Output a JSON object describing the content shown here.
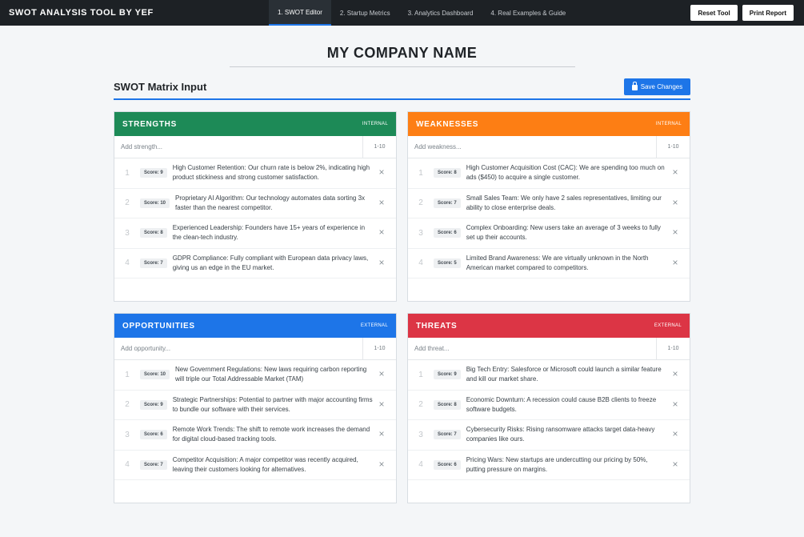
{
  "brand": "SWOT ANALYSIS TOOL BY YEF",
  "tabs": [
    "1. SWOT Editor",
    "2. Startup Metrics",
    "3. Analytics Dashboard",
    "4. Real Examples & Guide"
  ],
  "actions": {
    "reset": "Reset Tool",
    "print": "Print Report"
  },
  "company": {
    "name": "MY COMPANY NAME"
  },
  "matrix": {
    "title": "SWOT Matrix Input",
    "save_label": "Save Changes"
  },
  "colors": {
    "strengths": "#1d8a57",
    "weaknesses": "#fd7e14",
    "opportunities": "#1d75e8",
    "threats": "#dc3545",
    "accent": "#1d75e8"
  },
  "quadrants": {
    "strengths": {
      "title": "STRENGTHS",
      "tag": "INTERNAL",
      "placeholder": "Add strength...",
      "score_placeholder": "1-10",
      "items": [
        {
          "num": "1",
          "score": "Score: 9",
          "text": "High Customer Retention: Our churn rate is below 2%, indicating high product stickiness and strong customer satisfaction."
        },
        {
          "num": "2",
          "score": "Score: 10",
          "text": "Proprietary AI Algorithm: Our technology automates data sorting 3x faster than the nearest competitor."
        },
        {
          "num": "3",
          "score": "Score: 8",
          "text": "Experienced Leadership: Founders have 15+ years of experience in the clean-tech industry."
        },
        {
          "num": "4",
          "score": "Score: 7",
          "text": "GDPR Compliance: Fully compliant with European data privacy laws, giving us an edge in the EU market."
        }
      ]
    },
    "weaknesses": {
      "title": "WEAKNESSES",
      "tag": "INTERNAL",
      "placeholder": "Add weakness...",
      "score_placeholder": "1-10",
      "items": [
        {
          "num": "1",
          "score": "Score: 8",
          "text": "High Customer Acquisition Cost (CAC): We are spending too much on ads ($450) to acquire a single customer."
        },
        {
          "num": "2",
          "score": "Score: 7",
          "text": "Small Sales Team: We only have 2 sales representatives, limiting our ability to close enterprise deals."
        },
        {
          "num": "3",
          "score": "Score: 6",
          "text": "Complex Onboarding: New users take an average of 3 weeks to fully set up their accounts."
        },
        {
          "num": "4",
          "score": "Score: 5",
          "text": "Limited Brand Awareness: We are virtually unknown in the North American market compared to competitors."
        }
      ]
    },
    "opportunities": {
      "title": "OPPORTUNITIES",
      "tag": "EXTERNAL",
      "placeholder": "Add opportunity...",
      "score_placeholder": "1-10",
      "items": [
        {
          "num": "1",
          "score": "Score: 10",
          "text": "New Government Regulations: New laws requiring carbon reporting will triple our Total Addressable Market (TAM)"
        },
        {
          "num": "2",
          "score": "Score: 9",
          "text": "Strategic Partnerships: Potential to partner with major accounting firms to bundle our software with their services."
        },
        {
          "num": "3",
          "score": "Score: 6",
          "text": "Remote Work Trends: The shift to remote work increases the demand for digital cloud-based tracking tools."
        },
        {
          "num": "4",
          "score": "Score: 7",
          "text": "Competitor Acquisition: A major competitor was recently acquired, leaving their customers looking for alternatives."
        }
      ]
    },
    "threats": {
      "title": "THREATS",
      "tag": "EXTERNAL",
      "placeholder": "Add threat...",
      "score_placeholder": "1-10",
      "items": [
        {
          "num": "1",
          "score": "Score: 9",
          "text": "Big Tech Entry: Salesforce or Microsoft could launch a similar feature and kill our market share."
        },
        {
          "num": "2",
          "score": "Score: 8",
          "text": "Economic Downturn: A recession could cause B2B clients to freeze software budgets."
        },
        {
          "num": "3",
          "score": "Score: 7",
          "text": "Cybersecurity Risks: Rising ransomware attacks target data-heavy companies like ours."
        },
        {
          "num": "4",
          "score": "Score: 6",
          "text": "Pricing Wars: New startups are undercutting our pricing by 50%, putting pressure on margins."
        }
      ]
    }
  }
}
